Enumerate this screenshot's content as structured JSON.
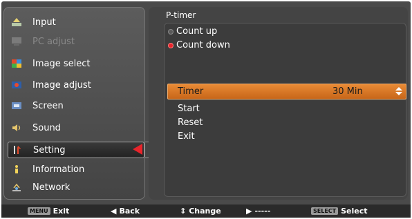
{
  "menu": {
    "items": [
      {
        "label": "Input",
        "icon": "input-icon",
        "state": "normal"
      },
      {
        "label": "PC adjust",
        "icon": "pc-adjust-icon",
        "state": "disabled"
      },
      {
        "label": "Image select",
        "icon": "image-select-icon",
        "state": "normal"
      },
      {
        "label": "Image adjust",
        "icon": "image-adjust-icon",
        "state": "normal"
      },
      {
        "label": "Screen",
        "icon": "screen-icon",
        "state": "normal"
      },
      {
        "label": "Sound",
        "icon": "sound-icon",
        "state": "normal"
      },
      {
        "label": "Setting",
        "icon": "setting-icon",
        "state": "selected"
      },
      {
        "label": "Information",
        "icon": "information-icon",
        "state": "normal"
      },
      {
        "label": "Network",
        "icon": "network-icon",
        "state": "normal"
      }
    ]
  },
  "panel": {
    "title": "P-timer",
    "options": [
      {
        "label": "Count up",
        "selected": false
      },
      {
        "label": "Count down",
        "selected": true
      }
    ],
    "timer": {
      "label": "Timer",
      "value": "30 Min"
    },
    "actions": [
      "Start",
      "Reset",
      "Exit"
    ]
  },
  "footer": {
    "exit": {
      "key": "MENU",
      "label": "Exit"
    },
    "back": {
      "glyph": "◀",
      "label": "Back"
    },
    "change": {
      "glyph": "⇕",
      "label": "Change"
    },
    "next": {
      "glyph": "▶",
      "label": "-----"
    },
    "select": {
      "key": "SELECT",
      "label": "Select"
    }
  },
  "colors": {
    "highlight": "#d9772a",
    "selection_arrow": "#e8242b",
    "background": "#4a4a4a"
  }
}
